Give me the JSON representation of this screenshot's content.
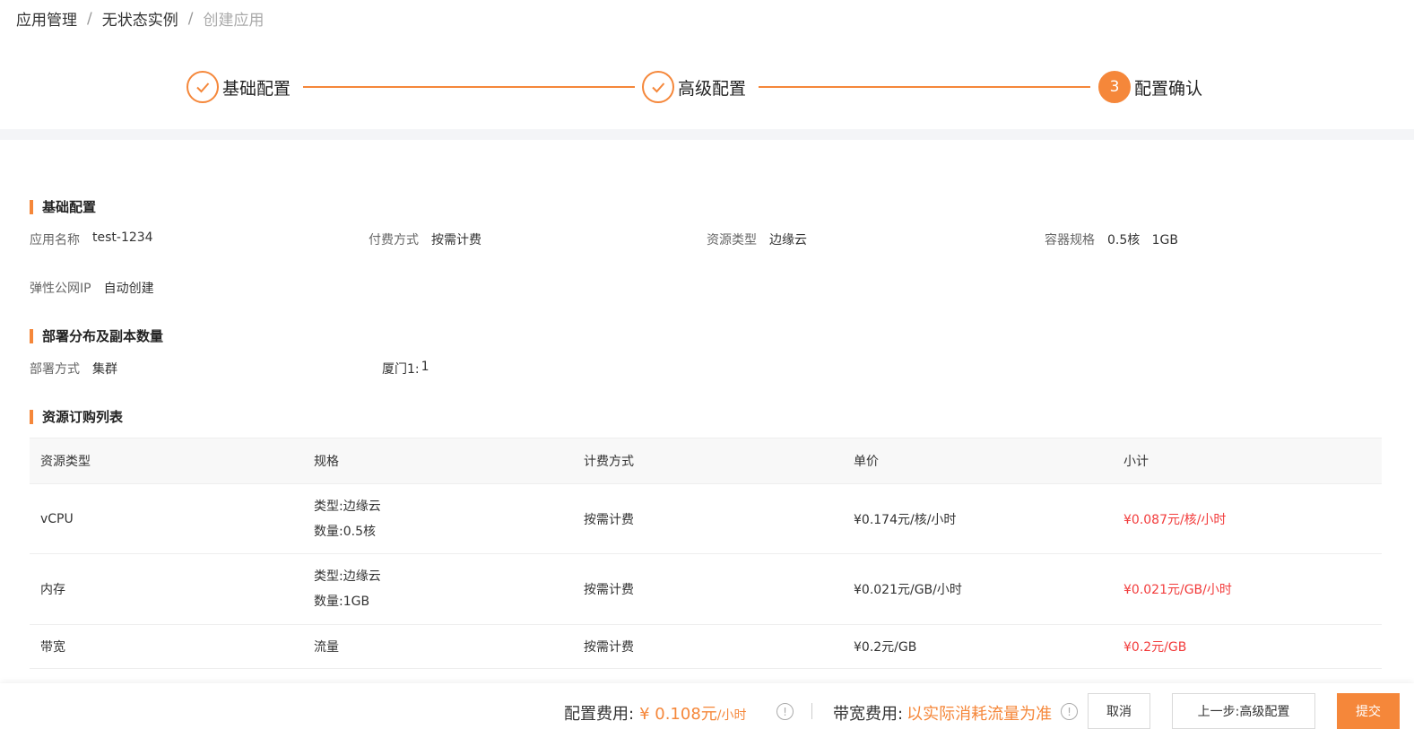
{
  "breadcrumb": {
    "items": [
      "应用管理",
      "无状态实例",
      "创建应用"
    ],
    "separator": "/"
  },
  "steps": [
    {
      "label": "基础配置",
      "status": "done",
      "icon": "check-icon"
    },
    {
      "label": "高级配置",
      "status": "done",
      "icon": "check-icon"
    },
    {
      "label": "配置确认",
      "status": "active",
      "number": "3"
    }
  ],
  "basic": {
    "title": "基础配置",
    "app_name_label": "应用名称",
    "app_name_value": "test-1234",
    "pay_label": "付费方式",
    "pay_value": "按需计费",
    "resource_type_label": "资源类型",
    "resource_type_value": "边缘云",
    "container_label": "容器规格",
    "container_value": "0.5核   1GB",
    "eip_label": "弹性公网IP",
    "eip_value": "自动创建"
  },
  "deploy": {
    "title": "部署分布及副本数量",
    "mode_label": "部署方式",
    "mode_value": "集群",
    "location_label": "厦门1:",
    "location_value": "1"
  },
  "resources": {
    "title": "资源订购列表",
    "columns": [
      "资源类型",
      "规格",
      "计费方式",
      "单价",
      "小计"
    ],
    "rows": [
      {
        "type": "vCPU",
        "spec": [
          "类型:边缘云",
          "数量:0.5核"
        ],
        "billing": "按需计费",
        "price": "¥0.174元/核/小时",
        "subtotal": "¥0.087元/核/小时"
      },
      {
        "type": "内存",
        "spec": [
          "类型:边缘云",
          "数量:1GB"
        ],
        "billing": "按需计费",
        "price": "¥0.021元/GB/小时",
        "subtotal": "¥0.021元/GB/小时"
      },
      {
        "type": "带宽",
        "spec": [
          "流量"
        ],
        "billing": "按需计费",
        "price": "¥0.2元/GB",
        "subtotal": "¥0.2元/GB"
      }
    ]
  },
  "footer": {
    "config_fee_label": "配置费用:",
    "config_fee_value": "¥ 0.108元",
    "config_fee_unit": "/小时",
    "bandwidth_fee_label": "带宽费用:",
    "bandwidth_fee_value": "以实际消耗流量为准",
    "info_icon": "!",
    "cancel_label": "取消",
    "prev_label": "上一步:高级配置",
    "submit_label": "提交"
  },
  "colors": {
    "accent": "#f5873a",
    "price_red": "#f23b3b"
  }
}
